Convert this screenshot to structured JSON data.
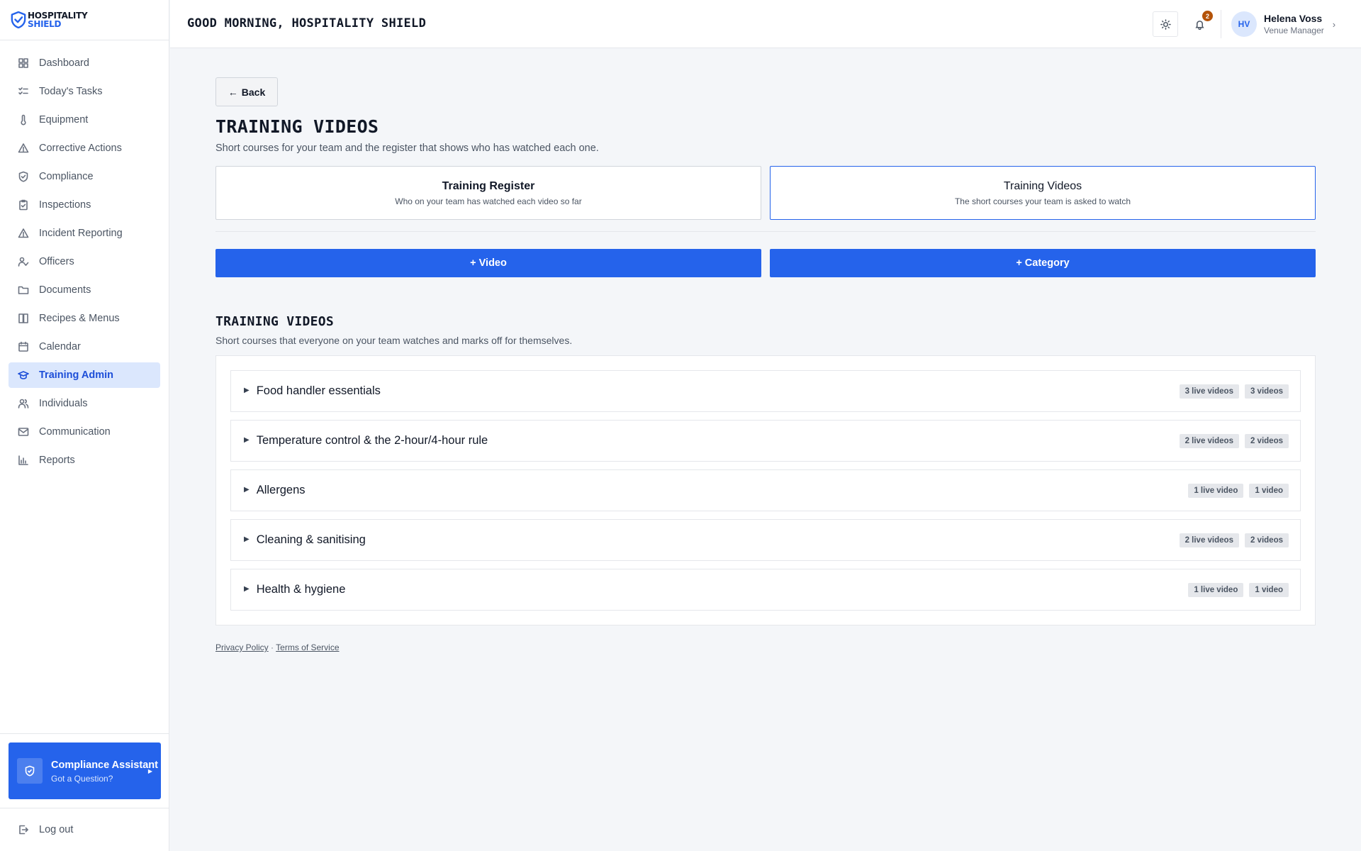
{
  "brand": {
    "line1": "HOSPITALITY",
    "line2": "SHIELD",
    "accent": "#2563eb"
  },
  "sidebar": {
    "items": [
      {
        "label": "Dashboard",
        "icon": "grid-icon"
      },
      {
        "label": "Today's Tasks",
        "icon": "checklist-icon"
      },
      {
        "label": "Equipment",
        "icon": "thermometer-icon"
      },
      {
        "label": "Corrective Actions",
        "icon": "warning-icon"
      },
      {
        "label": "Compliance",
        "icon": "shield-icon"
      },
      {
        "label": "Inspections",
        "icon": "clipboard-icon"
      },
      {
        "label": "Incident Reporting",
        "icon": "warning-icon"
      },
      {
        "label": "Officers",
        "icon": "user-check-icon"
      },
      {
        "label": "Documents",
        "icon": "folder-icon"
      },
      {
        "label": "Recipes & Menus",
        "icon": "book-icon"
      },
      {
        "label": "Calendar",
        "icon": "calendar-icon"
      },
      {
        "label": "Training Admin",
        "icon": "graduation-cap-icon",
        "active": true
      },
      {
        "label": "Individuals",
        "icon": "users-icon"
      },
      {
        "label": "Communication",
        "icon": "mail-icon"
      },
      {
        "label": "Reports",
        "icon": "bar-chart-icon"
      }
    ],
    "assistant": {
      "title": "Compliance Assistant",
      "subtitle": "Got a Question?"
    },
    "logout": "Log out"
  },
  "header": {
    "greeting": "GOOD MORNING, HOSPITALITY SHIELD",
    "notifications_count": "2",
    "user": {
      "initials": "HV",
      "name": "Helena Voss",
      "role": "Venue Manager"
    }
  },
  "main": {
    "back_label": "Back",
    "title": "TRAINING VIDEOS",
    "subtitle": "Short courses for your team and the register that shows who has watched each one.",
    "tabs": [
      {
        "title": "Training Register",
        "subtitle": "Who on your team has watched each video so far"
      },
      {
        "title": "Training Videos",
        "subtitle": "The short courses your team is asked to watch"
      }
    ],
    "actions": {
      "add_video": "+ Video",
      "add_category": "+ Category"
    },
    "section": {
      "title": "TRAINING VIDEOS",
      "subtitle": "Short courses that everyone on your team watches and marks off for themselves."
    },
    "categories": [
      {
        "name": "Food handler essentials",
        "live": "3 live videos",
        "total": "3 videos"
      },
      {
        "name": "Temperature control & the 2-hour/4-hour rule",
        "live": "2 live videos",
        "total": "2 videos"
      },
      {
        "name": "Allergens",
        "live": "1 live video",
        "total": "1 video"
      },
      {
        "name": "Cleaning & sanitising",
        "live": "2 live videos",
        "total": "2 videos"
      },
      {
        "name": "Health & hygiene",
        "live": "1 live video",
        "total": "1 video"
      }
    ],
    "footer": {
      "privacy": "Privacy Policy",
      "separator": "·",
      "terms": "Terms of Service"
    }
  }
}
